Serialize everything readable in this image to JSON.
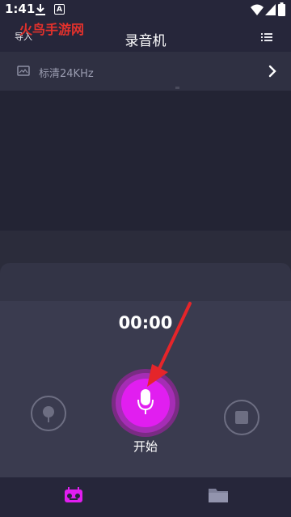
{
  "status": {
    "time": "1:41",
    "a_icon_letter": "A"
  },
  "watermark": "火鸟手游网",
  "header": {
    "import_label": "导入",
    "title": "录音机"
  },
  "quality": {
    "label": "标清24KHz"
  },
  "recorder": {
    "timer": "00:00",
    "start_label": "开始"
  },
  "colors": {
    "accent": "#e11ef0",
    "annotation_arrow": "#e5252a",
    "watermark": "#e2312c"
  },
  "icons": [
    "download-icon",
    "wifi-icon",
    "signal-icon",
    "battery-icon",
    "list-icon",
    "image-quality-icon",
    "chevron-right-icon",
    "pin-icon",
    "microphone-icon",
    "stop-icon",
    "recorder-tab-icon",
    "folder-tab-icon"
  ]
}
